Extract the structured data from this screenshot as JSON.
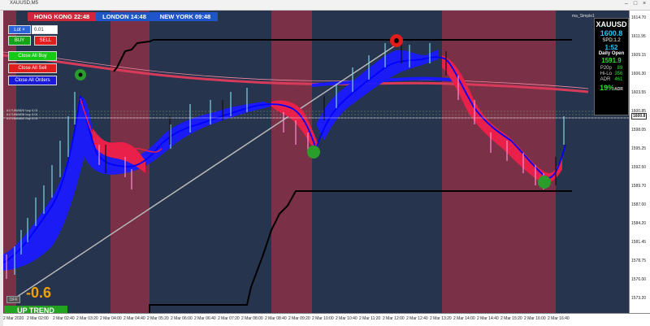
{
  "window": {
    "title": "XAUUSD,M5",
    "tab_label": "ma_Simple1"
  },
  "sessions": [
    {
      "label": "HONG KONG",
      "time": "22:48",
      "color": "#d0263a"
    },
    {
      "label": "LONDON",
      "time": "14:48",
      "color": "#1e56c8"
    },
    {
      "label": "NEW YORK",
      "time": "09:48",
      "color": "#1e56c8"
    }
  ],
  "trade_panel": {
    "lot_label": "Lot",
    "lot_value": "0.01",
    "buy_label": "BUY",
    "sell_label": "SELL",
    "close_buy_label": "Close All Buy",
    "close_sell_label": "Close All Sell",
    "close_all_label": "Close All Orders"
  },
  "info_panel": {
    "symbol": "XAUUSD",
    "price": "1600.8",
    "spread_label": "SPD:",
    "spread_value": "1.2",
    "time_left": "1:52",
    "daily_open_label": "Daily Open",
    "daily_open_value": "1591.9",
    "p20p_label": "P20p",
    "p20p_value": "89",
    "hilo_label": "Hi-Lo",
    "hilo_value": "356",
    "adr_label": "ADR",
    "adr_value": "461",
    "adr_pct": "19%",
    "adr_suffix": "ADR"
  },
  "indicator": {
    "pips_value": "-0.6",
    "trend_label": "UP TREND",
    "off_label": "OFF"
  },
  "order_lines": [
    "#171868820 buy 0.01",
    "#171868836 buy 0.01",
    "#171868852 buy 0.01"
  ],
  "price_axis": [
    "1614.70",
    "1611.95",
    "1609.15",
    "1606.30",
    "1603.55",
    "1600.85",
    "1598.05",
    "1595.25",
    "1592.50",
    "1589.70",
    "1587.00",
    "1584.20",
    "1581.45",
    "1578.75",
    "1576.00",
    "1573.20"
  ],
  "time_axis": [
    "2 Mar 2020",
    "2 Mar 02:00",
    "2 Mar 02:40",
    "2 Mar 03:20",
    "2 Mar 04:00",
    "2 Mar 04:40",
    "2 Mar 05:20",
    "2 Mar 06:00",
    "2 Mar 06:40",
    "2 Mar 07:20",
    "2 Mar 08:00",
    "2 Mar 08:40",
    "2 Mar 09:20",
    "2 Mar 10:00",
    "2 Mar 10:40",
    "2 Mar 11:20",
    "2 Mar 12:00",
    "2 Mar 12:40",
    "2 Mar 13:20",
    "2 Mar 14:00",
    "2 Mar 14:40",
    "2 Mar 15:20",
    "2 Mar 16:00",
    "2 Mar 16:40"
  ],
  "colors": {
    "bull_ribbon": "#1a1aff",
    "bear_ribbon": "#e8204a",
    "long_ma": "#d83a5a",
    "channel": "#000000",
    "trendline": "#b8b8b8"
  }
}
